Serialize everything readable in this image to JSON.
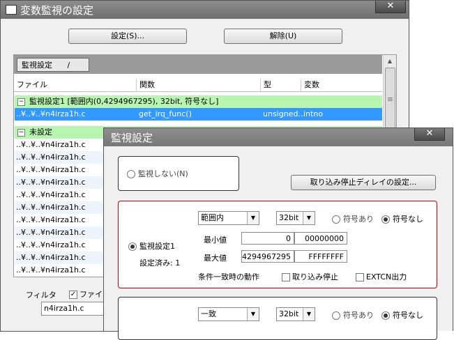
{
  "main_window": {
    "title": "変数監視の設定",
    "close": "✕",
    "set_button": "設定(S)...",
    "release_button": "解除(U)",
    "tab_label": "監視設定",
    "columns": [
      "ファイル",
      "関数",
      "型",
      "変数"
    ],
    "group1_label": "監視設定1 [範囲内(0,4294967295), 32bit, 符号なし]",
    "group1_row": {
      "file": "..¥..¥..¥n4irza1h.c",
      "func": "get_irq_func()",
      "type": "unsigned...",
      "var": "intno"
    },
    "group2_label": "未設定",
    "file_rows": [
      "..¥..¥..¥n4irza1h.c",
      "..¥..¥..¥n4irza1h.c",
      "..¥..¥..¥n4irza1h.c",
      "..¥..¥..¥n4irza1h.c",
      "..¥..¥..¥n4irza1h.c",
      "..¥..¥..¥n4irza1h.c",
      "..¥..¥..¥n4irza1h.c",
      "..¥..¥..¥n4irza1h.c",
      "..¥..¥..¥n4irza1h.c",
      "..¥..¥..¥n4irza1h.c",
      "..¥..¥..¥n4irza1h.c"
    ],
    "filter_label": "フィルタ",
    "filter_check_label": "ファイル",
    "filter_value": "n4irza1h.c"
  },
  "dialog": {
    "title": "監視設定",
    "close": "✕",
    "no_monitor": "監視しない(N)",
    "delay_button": "取り込み停止ディレイの設定...",
    "setting1": {
      "radio_label": "監視設定1",
      "status": "設定済み: 1",
      "condition": "範囲内",
      "width": "32bit",
      "signed": "符号あり",
      "unsigned": "符号なし",
      "min_label": "最小値",
      "min_dec": "0",
      "min_hex": "00000000",
      "max_label": "最大値",
      "max_dec": "4294967295",
      "max_hex": "FFFFFFFF",
      "action_label": "条件一致時の動作",
      "stop_capture": "取り込み停止",
      "extcn": "EXTCN出力"
    },
    "setting2": {
      "condition": "一致",
      "width": "32bit",
      "signed": "符号あり",
      "unsigned": "符号なし"
    }
  }
}
